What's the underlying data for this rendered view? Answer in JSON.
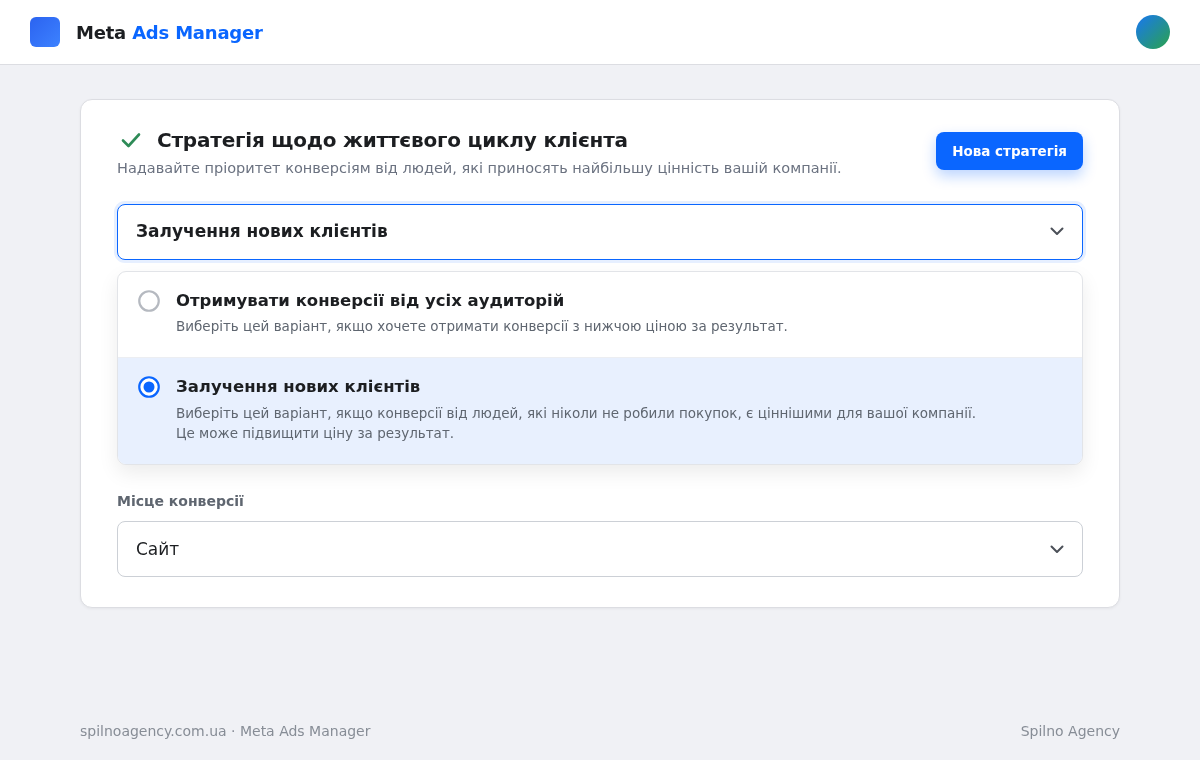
{
  "app": {
    "brand": "Meta",
    "brand_accent": "Ads Manager"
  },
  "strategy": {
    "title": "Стратегія щодо життєвого циклу клієнта",
    "subtitle": "Надавайте пріоритет конверсіям від людей, які приносять найбільшу цінність вашій компанії.",
    "new_button": "Нова стратегія",
    "select": {
      "value": "Залучення нових клієнтів",
      "expanded": true
    },
    "options": [
      {
        "title": "Отримувати конверсії від усіх аудиторій",
        "description": "Виберіть цей варіант, якщо хочете отримати конверсії з нижчою ціною за результат.",
        "selected": false
      },
      {
        "title": "Залучення нових клієнтів",
        "description": "Виберіть цей варіант, якщо конверсії від людей, які ніколи не робили покупок, є ціннішими для вашої компанії.\nЦе може підвищити ціну за результат.",
        "selected": true
      }
    ]
  },
  "conversion_location": {
    "label": "Місце конверсії",
    "value": "Сайт"
  },
  "footer": {
    "left": "spilnoagency.com.ua · Meta Ads Manager",
    "right": "Spilno Agency"
  }
}
